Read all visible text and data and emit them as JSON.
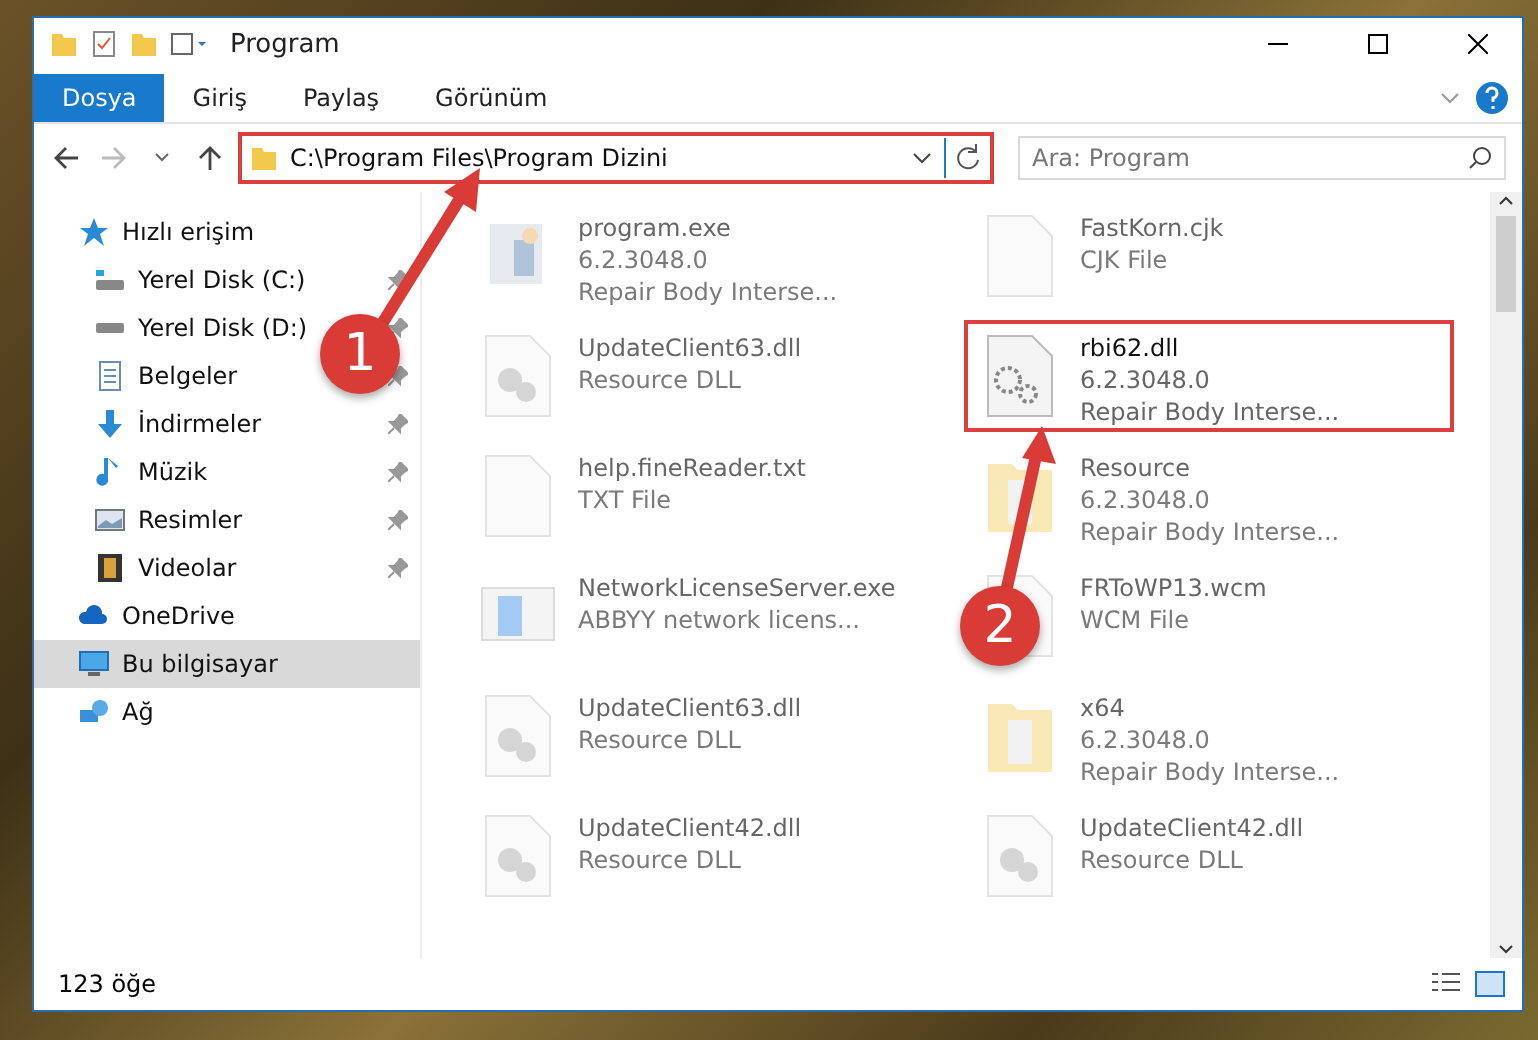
{
  "window": {
    "title": "Program"
  },
  "ribbon_tabs": [
    {
      "label": "Dosya",
      "selected": true
    },
    {
      "label": "Giriş",
      "selected": false
    },
    {
      "label": "Paylaş",
      "selected": false
    },
    {
      "label": "Görünüm",
      "selected": false
    }
  ],
  "address": {
    "path": "C:\\Program Files\\Program Dizini",
    "highlighted": true
  },
  "search": {
    "placeholder": "Ara: Program"
  },
  "sidebar": {
    "items": [
      {
        "label": "Hızlı erişim",
        "kind": "quick",
        "pinned": false,
        "selected": false,
        "children": [
          {
            "label": "Yerel Disk (C:)",
            "kind": "disk-c",
            "pinned": true,
            "selected": false
          },
          {
            "label": "Yerel Disk (D:)",
            "kind": "disk",
            "pinned": true,
            "selected": false
          },
          {
            "label": "Belgeler",
            "kind": "docs",
            "pinned": true,
            "selected": false
          },
          {
            "label": "İndirmeler",
            "kind": "download",
            "pinned": true,
            "selected": false
          },
          {
            "label": "Müzik",
            "kind": "music",
            "pinned": true,
            "selected": false
          },
          {
            "label": "Resimler",
            "kind": "pictures",
            "pinned": true,
            "selected": false
          },
          {
            "label": "Videolar",
            "kind": "videos",
            "pinned": true,
            "selected": false
          }
        ]
      },
      {
        "label": "OneDrive",
        "kind": "cloud",
        "pinned": false,
        "selected": false
      },
      {
        "label": "Bu bilgisayar",
        "kind": "pc",
        "pinned": false,
        "selected": true
      },
      {
        "label": "Ağ",
        "kind": "network",
        "pinned": false,
        "selected": false
      }
    ]
  },
  "files": [
    {
      "name": "program.exe",
      "lines": [
        "6.2.3048.0",
        "Repair Body Interse..."
      ],
      "kind": "exe",
      "dimmed": true,
      "highlighted": false
    },
    {
      "name": "FastKorn.cjk",
      "lines": [
        "CJK File"
      ],
      "kind": "blank",
      "dimmed": true,
      "highlighted": false
    },
    {
      "name": "UpdateClient63.dll",
      "lines": [
        "Resource DLL"
      ],
      "kind": "dll",
      "dimmed": true,
      "highlighted": false
    },
    {
      "name": "rbi62.dll",
      "lines": [
        "6.2.3048.0",
        "Repair Body Interse..."
      ],
      "kind": "gears",
      "dimmed": false,
      "highlighted": true
    },
    {
      "name": "help.fineReader.txt",
      "lines": [
        "TXT File"
      ],
      "kind": "blank",
      "dimmed": true,
      "highlighted": false
    },
    {
      "name": "Resource",
      "lines": [
        "6.2.3048.0",
        "Repair Body Interse..."
      ],
      "kind": "folder",
      "dimmed": true,
      "highlighted": false
    },
    {
      "name": "NetworkLicenseServer.exe",
      "lines": [
        "ABBYY network licens..."
      ],
      "kind": "app",
      "dimmed": true,
      "highlighted": false
    },
    {
      "name": "FRToWP13.wcm",
      "lines": [
        "WCM File"
      ],
      "kind": "blank",
      "dimmed": true,
      "highlighted": false
    },
    {
      "name": "UpdateClient63.dll",
      "lines": [
        "Resource DLL"
      ],
      "kind": "dll",
      "dimmed": true,
      "highlighted": false
    },
    {
      "name": "x64",
      "lines": [
        "6.2.3048.0",
        "Repair Body Interse..."
      ],
      "kind": "folder",
      "dimmed": true,
      "highlighted": false
    },
    {
      "name": "UpdateClient42.dll",
      "lines": [
        "Resource DLL"
      ],
      "kind": "dll",
      "dimmed": true,
      "highlighted": false
    },
    {
      "name": "UpdateClient42.dll",
      "lines": [
        "Resource DLL"
      ],
      "kind": "dll",
      "dimmed": true,
      "highlighted": false
    }
  ],
  "status_bar": {
    "count": "123 öğe"
  },
  "annotations": [
    {
      "number": "1"
    },
    {
      "number": "2"
    }
  ]
}
